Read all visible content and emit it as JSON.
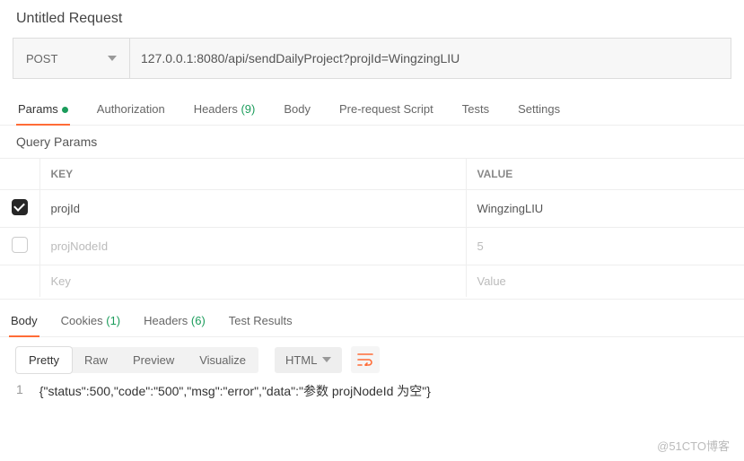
{
  "title": "Untitled Request",
  "request": {
    "method": "POST",
    "url": "127.0.0.1:8080/api/sendDailyProject?projId=WingzingLIU"
  },
  "tabs": {
    "params": "Params",
    "auth": "Authorization",
    "headers": "Headers",
    "headers_count": "(9)",
    "body": "Body",
    "prereq": "Pre-request Script",
    "tests": "Tests",
    "settings": "Settings"
  },
  "qp": {
    "title": "Query Params",
    "head_key": "KEY",
    "head_val": "VALUE",
    "rows": [
      {
        "checked": true,
        "key": "projId",
        "value": "WingzingLIU"
      },
      {
        "checked": false,
        "key": "projNodeId",
        "value": "5"
      }
    ],
    "ph_key": "Key",
    "ph_value": "Value"
  },
  "resp": {
    "tabs": {
      "body": "Body",
      "cookies": "Cookies",
      "cookies_count": "(1)",
      "headers": "Headers",
      "headers_count": "(6)",
      "tests": "Test Results"
    },
    "view": {
      "pretty": "Pretty",
      "raw": "Raw",
      "preview": "Preview",
      "visualize": "Visualize",
      "format": "HTML"
    },
    "line_no": "1",
    "body_text": "{\"status\":500,\"code\":\"500\",\"msg\":\"error\",\"data\":\"参数 projNodeId 为空\"}"
  },
  "watermark": "@51CTO博客"
}
